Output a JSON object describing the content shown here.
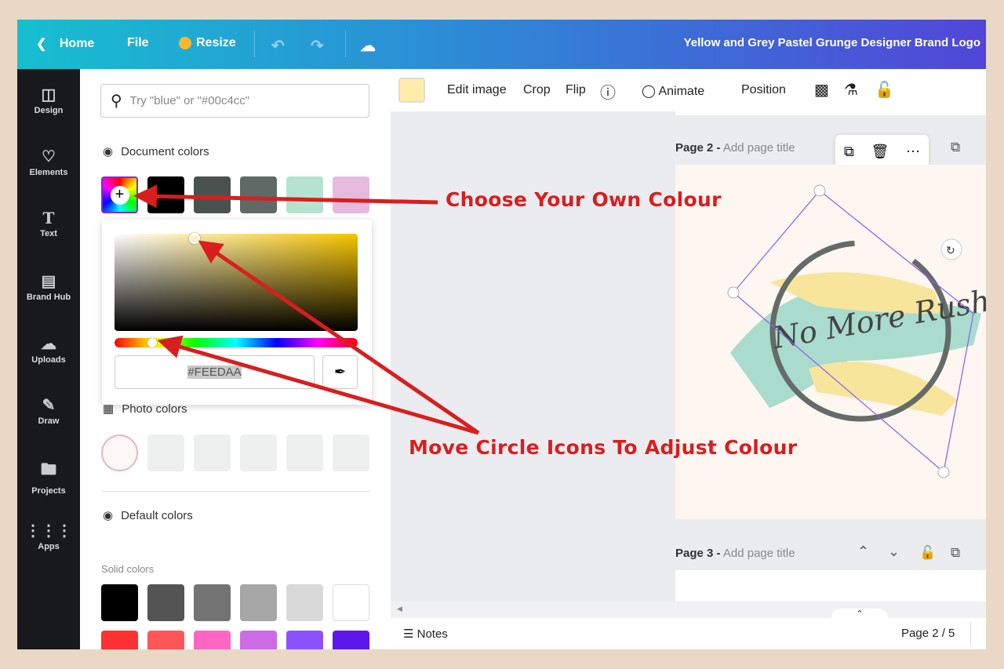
{
  "topbar": {
    "home": "Home",
    "file": "File",
    "resize": "Resize",
    "title": "Yellow and Grey Pastel Grunge Designer Brand Logo"
  },
  "sidebar": {
    "items": [
      {
        "label": "Design",
        "icon": "layout-icon"
      },
      {
        "label": "Elements",
        "icon": "shapes-icon"
      },
      {
        "label": "Text",
        "icon": "text-icon"
      },
      {
        "label": "Brand Hub",
        "icon": "brand-icon"
      },
      {
        "label": "Uploads",
        "icon": "cloud-upload-icon"
      },
      {
        "label": "Draw",
        "icon": "draw-icon"
      },
      {
        "label": "Projects",
        "icon": "folder-icon"
      },
      {
        "label": "Apps",
        "icon": "grid-icon"
      }
    ]
  },
  "panel": {
    "search_placeholder": "Try \"blue\" or \"#00c4cc\"",
    "document_colors": {
      "title": "Document colors",
      "swatches": [
        "#000000",
        "#4a5250",
        "#5f6966",
        "#b5e3d0",
        "#e6b9df"
      ]
    },
    "picker": {
      "hex": "#FEEDAA",
      "hue_color": "#f5c400"
    },
    "photo_colors": {
      "title": "Photo colors"
    },
    "default_colors": {
      "title": "Default colors",
      "solid_label": "Solid colors",
      "row1": [
        "#000000",
        "#545454",
        "#737373",
        "#a6a6a6",
        "#d9d9d9",
        "#ffffff"
      ],
      "row2": [
        "#ff3131",
        "#ff5757",
        "#ff66c4",
        "#cb6ce6",
        "#8c52ff",
        "#5e17eb"
      ]
    }
  },
  "toolbar": {
    "color": "#feedaa",
    "edit_image": "Edit image",
    "crop": "Crop",
    "flip": "Flip",
    "animate": "Animate",
    "position": "Position"
  },
  "canvas": {
    "page2": {
      "label": "Page 2 -",
      "placeholder": "Add page title"
    },
    "page3": {
      "label": "Page 3 -",
      "placeholder": "Add page title"
    },
    "logo_text": "No More Rush"
  },
  "bottom": {
    "notes": "Notes",
    "page_indicator": "Page 2 / 5"
  },
  "annotations": {
    "choose": "Choose Your Own Colour",
    "move": "Move Circle Icons To Adjust Colour",
    "color": "#d81e1e"
  }
}
